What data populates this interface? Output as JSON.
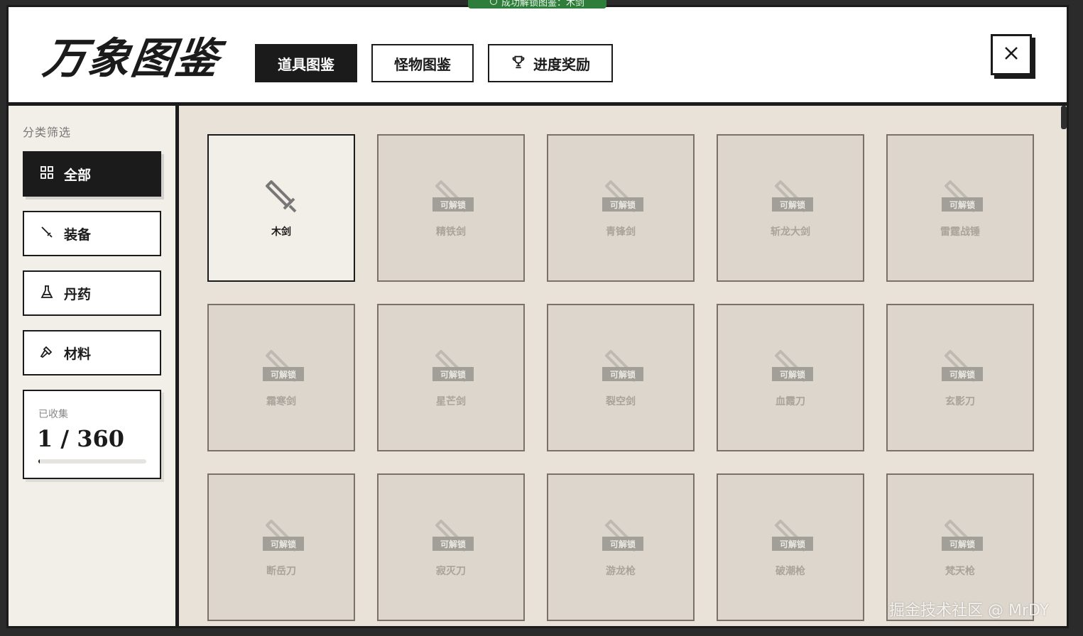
{
  "toast": {
    "text": "成功解锁图鉴：木剑"
  },
  "header": {
    "logo": "万象图鉴",
    "tabs": [
      {
        "label": "道具图鉴",
        "active": true
      },
      {
        "label": "怪物图鉴",
        "active": false
      },
      {
        "label": "进度奖励",
        "active": false,
        "icon": "trophy-icon"
      }
    ],
    "close_icon": "close-icon"
  },
  "sidebar": {
    "title": "分类筛选",
    "filters": [
      {
        "label": "全部",
        "icon": "grid-icon",
        "active": true
      },
      {
        "label": "装备",
        "icon": "sword-icon",
        "active": false
      },
      {
        "label": "丹药",
        "icon": "flask-icon",
        "active": false
      },
      {
        "label": "材料",
        "icon": "hammer-icon",
        "active": false
      }
    ],
    "stats": {
      "label": "已收集",
      "count_text": "1 / 360",
      "progress_fraction": 0.0028
    }
  },
  "grid": {
    "locked_badge": "可解锁",
    "items": [
      {
        "name": "木剑",
        "unlocked": true
      },
      {
        "name": "精铁剑",
        "unlocked": false
      },
      {
        "name": "青锋剑",
        "unlocked": false
      },
      {
        "name": "斩龙大剑",
        "unlocked": false
      },
      {
        "name": "雷霆战锤",
        "unlocked": false
      },
      {
        "name": "霜寒剑",
        "unlocked": false
      },
      {
        "name": "星芒剑",
        "unlocked": false
      },
      {
        "name": "裂空剑",
        "unlocked": false
      },
      {
        "name": "血霞刀",
        "unlocked": false
      },
      {
        "name": "玄影刀",
        "unlocked": false
      },
      {
        "name": "断岳刀",
        "unlocked": false
      },
      {
        "name": "寂灭刀",
        "unlocked": false
      },
      {
        "name": "游龙枪",
        "unlocked": false
      },
      {
        "name": "破潮枪",
        "unlocked": false
      },
      {
        "name": "梵天枪",
        "unlocked": false
      }
    ]
  },
  "watermark": "掘金技术社区 @ MrDY",
  "colors": {
    "ink": "#1b1b1b",
    "paper": "#e9e2d8",
    "toast": "#2e7d3a"
  }
}
